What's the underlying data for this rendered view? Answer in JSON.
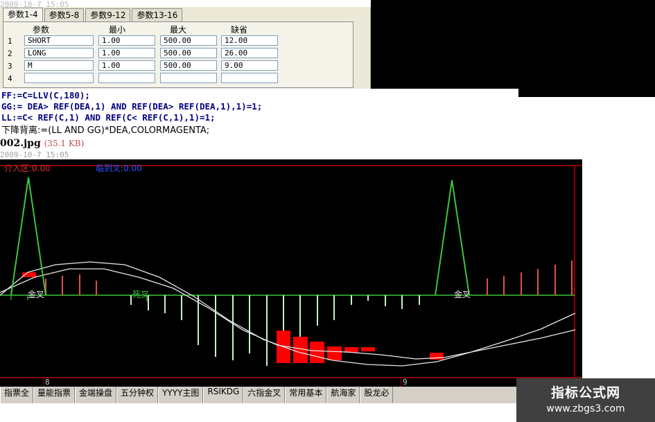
{
  "top_date": "2009-10-7 15:05",
  "param_tabs": [
    "参数1-4",
    "参数5-8",
    "参数9-12",
    "参数13-16"
  ],
  "param_headers": [
    "参数",
    "最小",
    "最大",
    "缺省"
  ],
  "param_rows": [
    {
      "no": "1",
      "name": "SHORT",
      "min": "1.00",
      "max": "500.00",
      "default": "12.00"
    },
    {
      "no": "2",
      "name": "LONG",
      "min": "1.00",
      "max": "500.00",
      "default": "26.00"
    },
    {
      "no": "3",
      "name": "M",
      "min": "1.00",
      "max": "500.00",
      "default": "9.00"
    },
    {
      "no": "4",
      "name": "",
      "min": "",
      "max": "",
      "default": ""
    }
  ],
  "code_lines": [
    "FF:=C=LLV(C,180);",
    "GG:= DEA> REF(DEA,1) AND REF(DEA> REF(DEA,1),1)=1;",
    "LL:=C< REF(C,1) AND REF(C< REF(C,1),1)=1;",
    "下降背离:=(LL AND GG)*DEA,COLORMAGENTA;"
  ],
  "file_name": "002.jpg",
  "file_size": "(35.1 KB)",
  "mid_date": "2009-10-7 15:05",
  "chart": {
    "legend_zone": "介入区:0.00",
    "legend_cross": "临到叉:0.00",
    "label_gold_left": "金叉",
    "label_death": "死叉",
    "label_gold_right": "金叉",
    "axis_8": "8",
    "axis_9": "9",
    "colors": {
      "background": "#000000",
      "frame": "#8b0000",
      "zero_line": "#3cc83c",
      "down_bar": "#c8f0c8",
      "up_bar": "#e05050",
      "block": "#ff0000",
      "line": "#e8e8e8",
      "spike": "#3cc83c"
    }
  },
  "bottom_tabs": [
    "指票全",
    "量能指票",
    "金端操盘",
    "五分钟权",
    "YYYY主图",
    "RSIKDG",
    "六指金叉",
    "常用基本",
    "航海家",
    "股龙必"
  ],
  "watermark": {
    "title": "指标公式网",
    "url": "www.zbgs3.com"
  }
}
